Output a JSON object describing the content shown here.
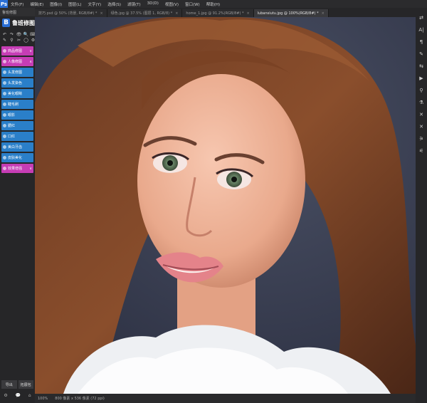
{
  "menubar": {
    "logo": "Ps",
    "items": [
      "文件(F)",
      "编辑(E)",
      "图像(I)",
      "图层(L)",
      "文字(Y)",
      "选择(S)",
      "滤镜(T)",
      "3D(D)",
      "视图(V)",
      "窗口(W)",
      "帮助(H)"
    ]
  },
  "tabs": [
    {
      "label": "技巧.psd @ 50% (背景, RGB/8#) *",
      "active": false
    },
    {
      "label": "绿色.jpg @ 37.5% (图层 1, RGB/8) *",
      "active": false
    },
    {
      "label": "home_1.jpg @ 91.2%(RGB/8#) *",
      "active": false
    },
    {
      "label": "lubansiutu.jpg @ 100%(RGB/8#) *",
      "active": true
    }
  ],
  "left_panel": {
    "header": "鲁班修图",
    "brand_logo": "B",
    "brand_name": "鲁班修图",
    "tool_icons": [
      "↶",
      "↷",
      "👁",
      "🔍",
      "⌨",
      "✎",
      "⚲",
      "✂",
      "◯",
      "⚙"
    ],
    "items": [
      {
        "label": "商品修图",
        "color": "pink",
        "chevron": "∨"
      },
      {
        "label": "人像修图",
        "color": "pink",
        "chevron": "∧"
      },
      {
        "label": "头发修图",
        "color": "blue",
        "chevron": ""
      },
      {
        "label": "头发染色",
        "color": "blue",
        "chevron": ""
      },
      {
        "label": "美化眼睛",
        "color": "blue",
        "chevron": ""
      },
      {
        "label": "睫毛刷",
        "color": "blue",
        "chevron": ""
      },
      {
        "label": "眼影",
        "color": "blue",
        "chevron": ""
      },
      {
        "label": "腮红",
        "color": "blue",
        "chevron": ""
      },
      {
        "label": "口红",
        "color": "blue",
        "chevron": ""
      },
      {
        "label": "美白牙齿",
        "color": "blue",
        "chevron": ""
      },
      {
        "label": "皮肤美化",
        "color": "blue",
        "chevron": ""
      },
      {
        "label": "效果增强",
        "color": "pink",
        "chevron": "∨"
      }
    ],
    "bottom_buttons": [
      "导出",
      "拓展包"
    ],
    "bottom_icons": [
      "⚙",
      "💬",
      "⌂"
    ]
  },
  "right_toolbar_icons": [
    "⇄",
    "A|",
    "¶",
    "✎",
    "⇆",
    "▶",
    "⚲",
    "⚗",
    "✕",
    "✕",
    "⚞",
    "⚟"
  ],
  "status": {
    "zoom": "100%",
    "doc_info": "800 像素 x 536 像素 (72 ppi)"
  },
  "colors": {
    "accent_pink": "#c63db5",
    "accent_blue": "#2a7fc9",
    "brand_blue": "#2a6fd6"
  }
}
